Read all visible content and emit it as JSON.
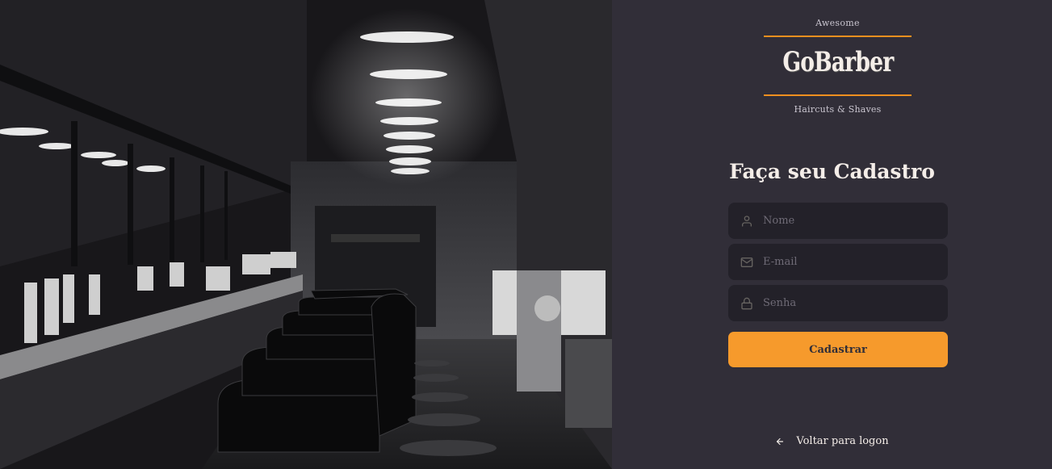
{
  "logo": {
    "top_text": "Awesome",
    "wordmark": "GoBarber",
    "bottom_text": "Haircuts & Shaves",
    "accent_color": "#f28f1f"
  },
  "form": {
    "title": "Faça seu Cadastro",
    "fields": [
      {
        "name": "name",
        "icon": "user-icon",
        "placeholder": "Nome",
        "value": ""
      },
      {
        "name": "email",
        "icon": "mail-icon",
        "placeholder": "E-mail",
        "value": ""
      },
      {
        "name": "password",
        "icon": "lock-icon",
        "placeholder": "Senha",
        "value": ""
      }
    ],
    "submit_label": "Cadastrar",
    "button_color": "#f69a2c"
  },
  "back_link": {
    "icon": "arrow-left-icon",
    "label": "Voltar para logon"
  },
  "colors": {
    "background": "#312e38",
    "input_background": "#232129",
    "text": "#f4ede8",
    "placeholder": "#6f6b76"
  }
}
